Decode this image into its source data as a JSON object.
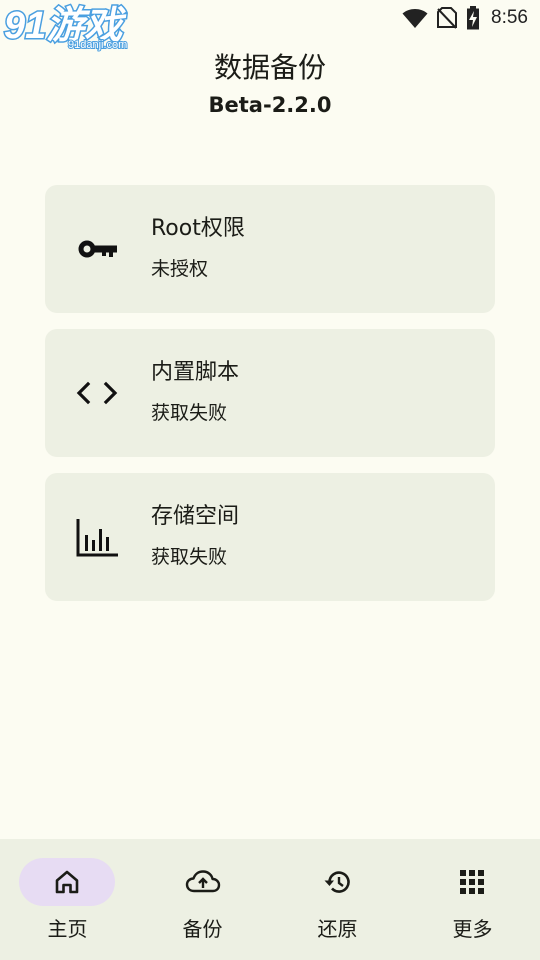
{
  "status_bar": {
    "watermark": "91游戏",
    "watermark_sub": "91danji.com",
    "time": "8:56",
    "icons": [
      "wifi-icon",
      "no-sim-icon",
      "battery-charging-icon"
    ]
  },
  "header": {
    "title": "数据备份",
    "version": "Beta-2.2.0"
  },
  "cards": [
    {
      "icon": "key-icon",
      "title": "Root权限",
      "subtitle": "未授权"
    },
    {
      "icon": "code-icon",
      "title": "内置脚本",
      "subtitle": "获取失败"
    },
    {
      "icon": "bar-chart-icon",
      "title": "存储空间",
      "subtitle": "获取失败"
    }
  ],
  "bottom_nav": {
    "items": [
      {
        "icon": "home-icon",
        "label": "主页",
        "active": true
      },
      {
        "icon": "cloud-upload-icon",
        "label": "备份",
        "active": false
      },
      {
        "icon": "history-icon",
        "label": "还原",
        "active": false
      },
      {
        "icon": "apps-grid-icon",
        "label": "更多",
        "active": false
      }
    ]
  },
  "colors": {
    "background": "#fcfcf2",
    "card": "#edf0e3",
    "nav_active_pill": "#e7dcf3",
    "text": "#1b1c17",
    "watermark": "#4a9fe0"
  }
}
